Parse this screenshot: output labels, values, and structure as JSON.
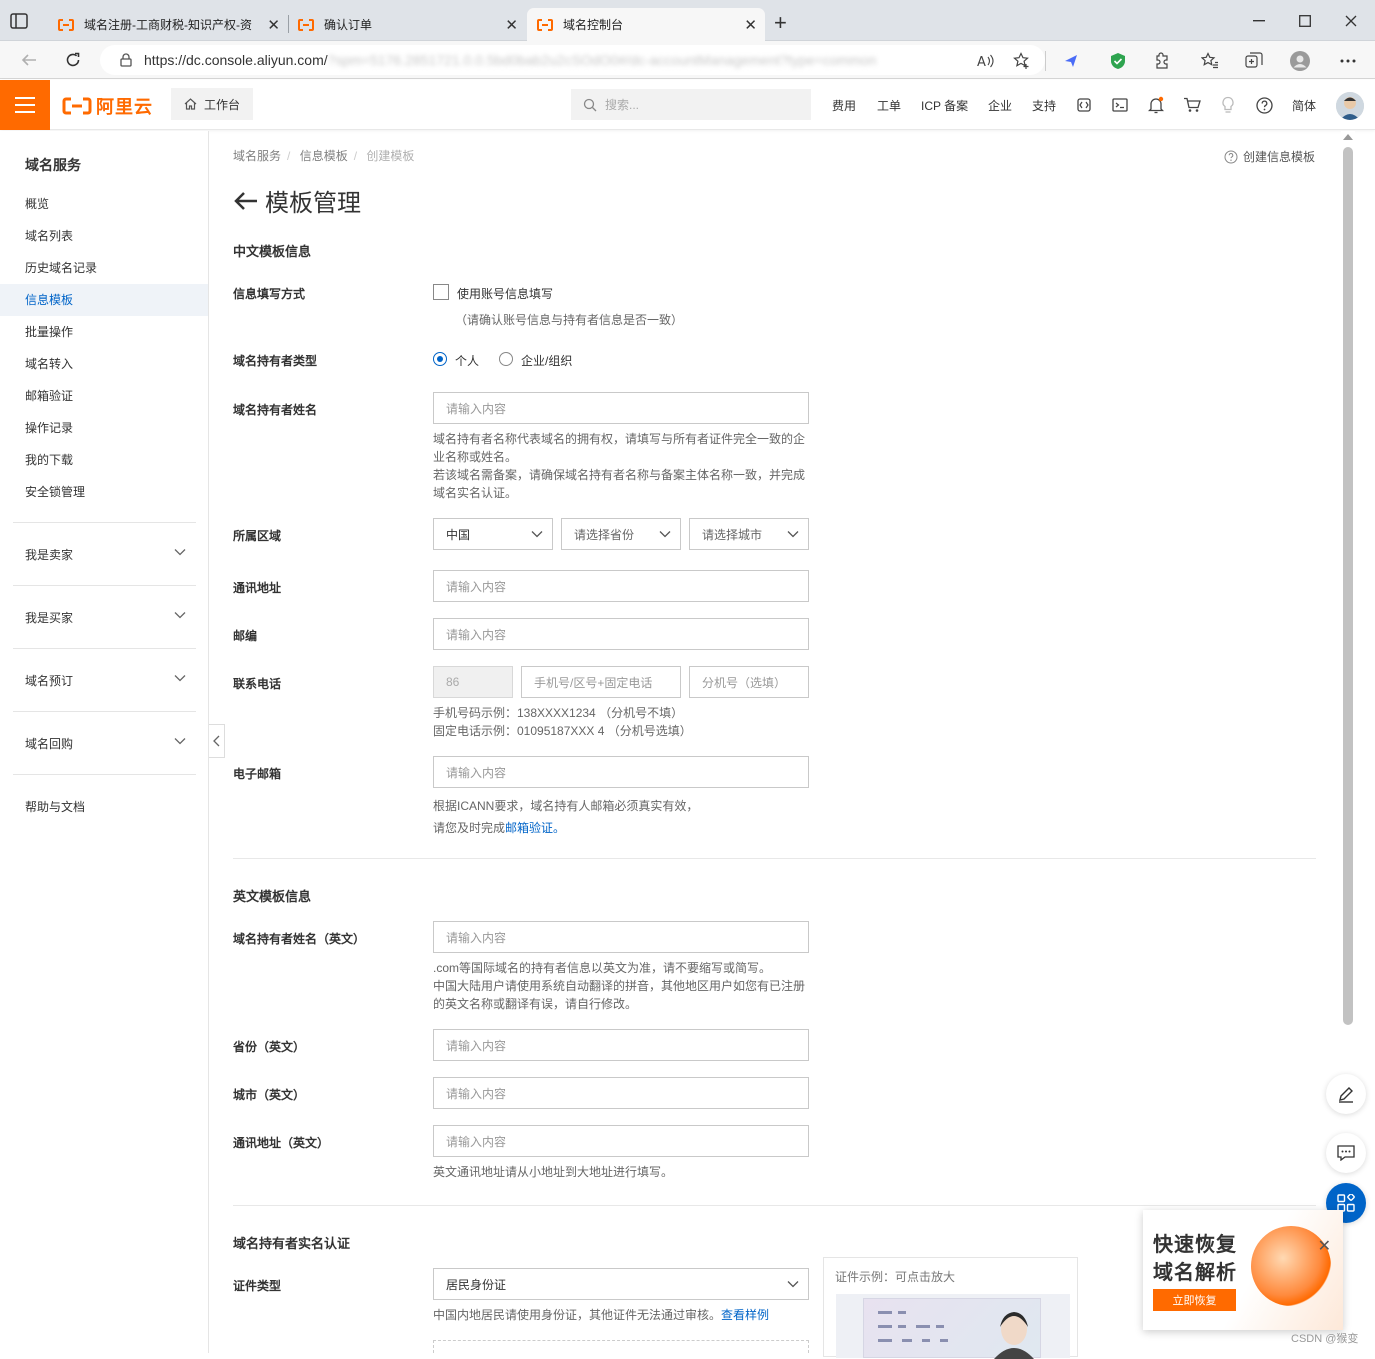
{
  "browser": {
    "tabs": [
      {
        "title": "域名注册-工商财税-知识产权-资"
      },
      {
        "title": "确认订单"
      },
      {
        "title": "域名控制台"
      }
    ],
    "url": "https://dc.console.aliyun.com/",
    "url_obscured": "?spm=5176.2851721.0.0.5bd0bab2u2cSOdO0#/dc-accountManagement?type=common"
  },
  "console": {
    "brand": "阿里云",
    "workbench": "工作台",
    "search_placeholder": "搜索...",
    "links": [
      "费用",
      "工单",
      "ICP 备案",
      "企业",
      "支持"
    ],
    "lang": "简体"
  },
  "sidebar": {
    "title": "域名服务",
    "items": [
      "概览",
      "域名列表",
      "历史域名记录",
      "信息模板",
      "批量操作",
      "域名转入",
      "邮箱验证",
      "操作记录",
      "我的下载",
      "安全锁管理"
    ],
    "active_index": 3,
    "groups": [
      "我是卖家",
      "我是买家",
      "域名预订",
      "域名回购"
    ],
    "help": "帮助与文档"
  },
  "page": {
    "breadcrumb": [
      "域名服务",
      "信息模板",
      "创建模板"
    ],
    "help_link": "创建信息模板",
    "title": "模板管理",
    "cn_section": "中文模板信息",
    "fill_mode_label": "信息填写方式",
    "use_account_info": "使用账号信息填写",
    "use_account_hint": "（请确认账号信息与持有者信息是否一致）",
    "owner_type_label": "域名持有者类型",
    "owner_type_options": [
      "个人",
      "企业/组织"
    ],
    "owner_type_selected": "个人",
    "owner_name_label": "域名持有者姓名",
    "owner_name_hint1": "域名持有者名称代表域名的拥有权，请填写与所有者证件完全一致的企",
    "owner_name_hint2": "业名称或姓名。",
    "owner_name_hint3": "若该域名需备案，请确保域名持有者名称与备案主体名称一致，并完成",
    "owner_name_hint4": "域名实名认证。",
    "region_label": "所属区域",
    "region_country": "中国",
    "region_province": "请选择省份",
    "region_city": "请选择城市",
    "address_label": "通讯地址",
    "zip_label": "邮编",
    "phone_label": "联系电话",
    "phone_cc": "86",
    "phone_placeholder": "手机号/区号+固定电话",
    "ext_placeholder": "分机号（选填）",
    "phone_hint1": "手机号码示例：138XXXX1234 （分机号不填）",
    "phone_hint2": "固定电话示例：01095187XXX 4 （分机号选填）",
    "email_label": "电子邮箱",
    "email_hint1": "根据ICANN要求，域名持有人邮箱必须真实有效，",
    "email_hint2_prefix": "请您及时完成",
    "email_hint2_link": "邮箱验证。",
    "input_placeholder": "请输入内容",
    "en_section": "英文模板信息",
    "en_name_label": "域名持有者姓名（英文）",
    "en_name_hint1": ".com等国际域名的持有者信息以英文为准，请不要缩写或简写。",
    "en_name_hint2": "中国大陆用户请使用系统自动翻译的拼音，其他地区用户如您有已注册",
    "en_name_hint3": "的英文名称或翻译有误，请自行修改。",
    "en_province_label": "省份（英文）",
    "en_city_label": "城市（英文）",
    "en_address_label": "通讯地址（英文）",
    "en_address_hint": "英文通讯地址请从小地址到大地址进行填写。",
    "verify_section": "域名持有者实名认证",
    "cert_type_label": "证件类型",
    "cert_type_value": "居民身份证",
    "cert_hint": "中国内地居民请使用身份证，其他证件无法通过审核。",
    "cert_hint_link": "查看样例",
    "cert_example_title": "证件示例：可点击放大"
  },
  "promo": {
    "line1": "快速恢复",
    "line2": "域名解析",
    "button": "立即恢复"
  },
  "watermark": "CSDN @猴变"
}
